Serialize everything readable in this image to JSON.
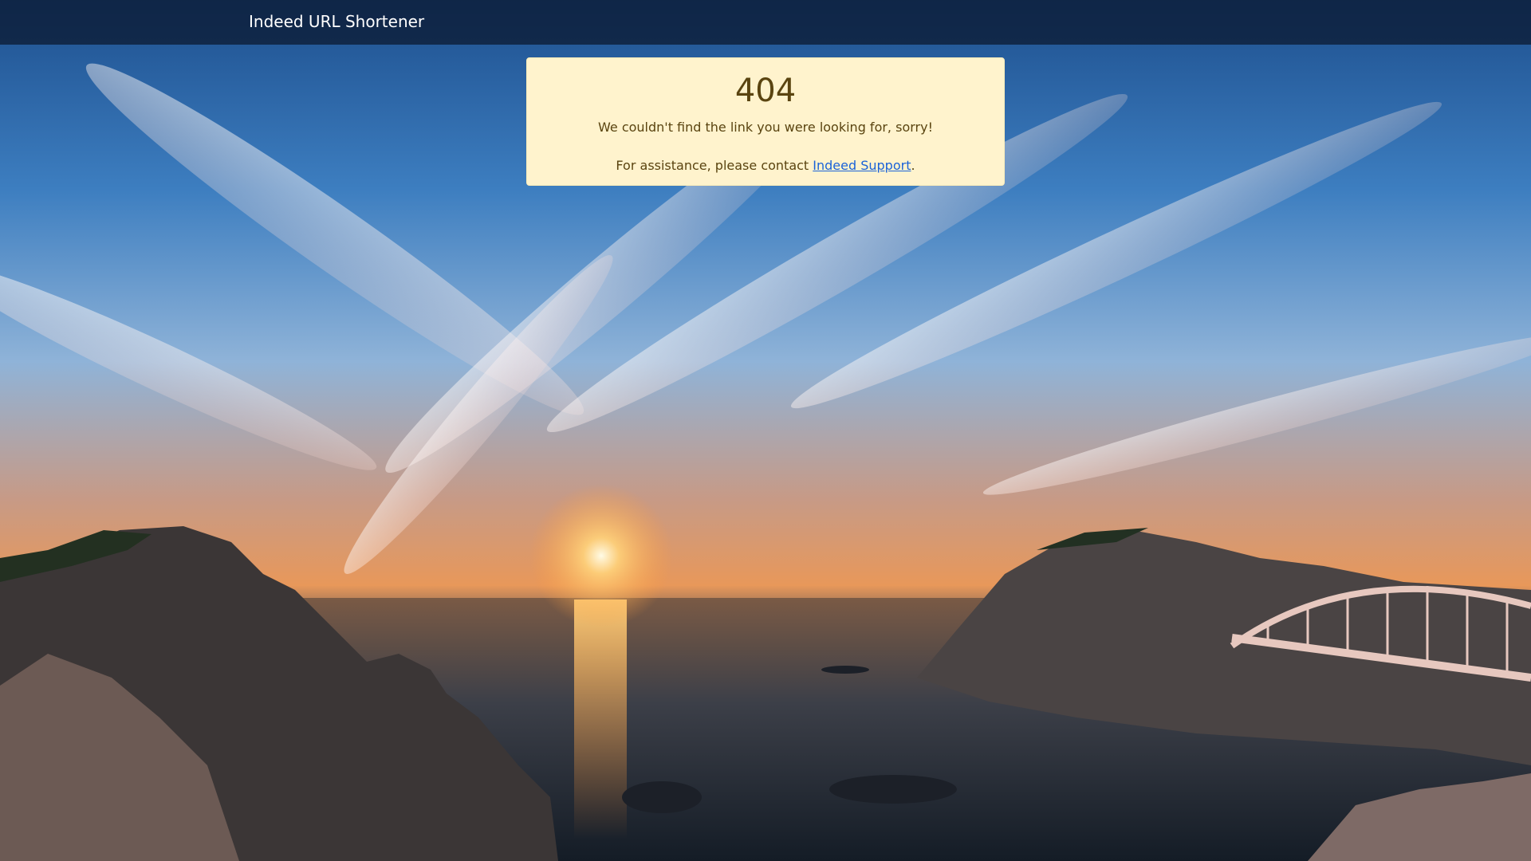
{
  "navbar": {
    "brand": "Indeed URL Shortener"
  },
  "error": {
    "code": "404",
    "message": "We couldn't find the link you were looking for, sorry!",
    "contact_prefix": "For assistance, please contact ",
    "contact_link": "Indeed Support",
    "contact_suffix": "."
  },
  "colors": {
    "alert_background": "#fff3cd",
    "alert_text": "#5a4410",
    "link": "#1a63d8",
    "navbar": "#0a162d"
  },
  "background": {
    "icon": "sunset-coast-photo"
  }
}
